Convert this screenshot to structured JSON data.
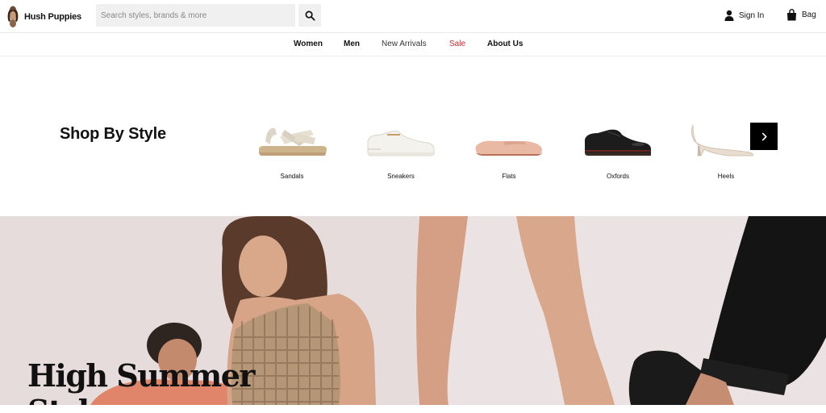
{
  "header": {
    "logo_text": "Hush Puppies",
    "search_placeholder": "Search styles, brands & more",
    "sign_in_label": "Sign In",
    "bag_label": "Bag"
  },
  "nav": {
    "items": [
      {
        "label": "Women"
      },
      {
        "label": "Men"
      },
      {
        "label": "New Arrivals"
      },
      {
        "label": "Sale",
        "color": "#d2262c"
      },
      {
        "label": "About Us"
      }
    ]
  },
  "shop_by_style": {
    "title": "Shop By Style",
    "tiles": [
      {
        "label": "Sandals",
        "icon": "sandal-icon"
      },
      {
        "label": "Sneakers",
        "icon": "sneaker-icon"
      },
      {
        "label": "Flats",
        "icon": "flat-icon"
      },
      {
        "label": "Oxfords",
        "icon": "oxford-icon"
      },
      {
        "label": "Heels",
        "icon": "heel-icon"
      }
    ]
  },
  "hero": {
    "headline": "High Summer\nStyle"
  },
  "colors": {
    "sale": "#d2262c",
    "hero_bg": "#e6dcdb"
  }
}
